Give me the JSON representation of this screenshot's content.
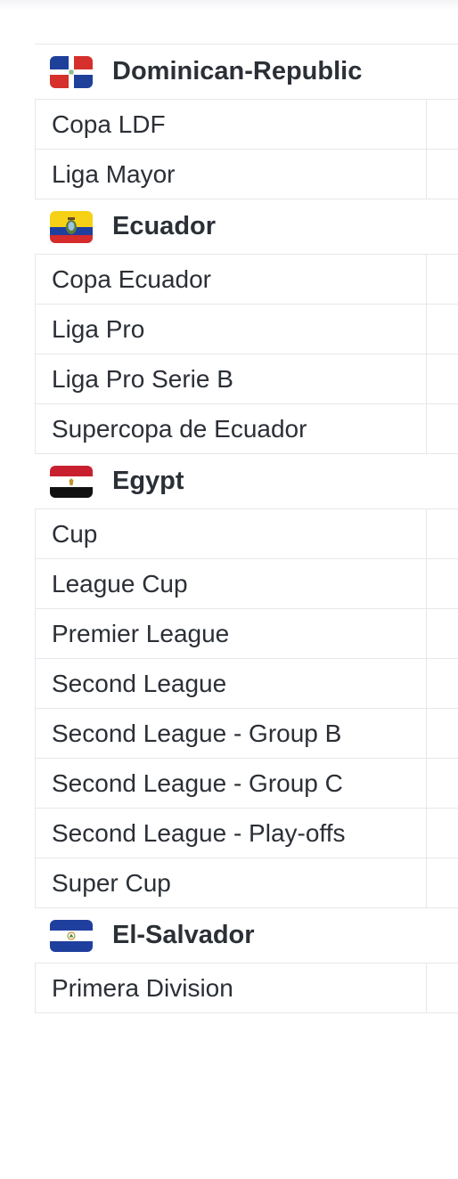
{
  "groups": [
    {
      "country": "Dominican-Republic",
      "flag_icon": "dominican-republic-flag-icon",
      "leagues": [
        "Copa LDF",
        "Liga Mayor"
      ]
    },
    {
      "country": "Ecuador",
      "flag_icon": "ecuador-flag-icon",
      "leagues": [
        "Copa Ecuador",
        "Liga Pro",
        "Liga Pro Serie B",
        "Supercopa de Ecuador"
      ]
    },
    {
      "country": "Egypt",
      "flag_icon": "egypt-flag-icon",
      "leagues": [
        "Cup",
        "League Cup",
        "Premier League",
        "Second League",
        "Second League - Group B",
        "Second League - Group C",
        "Second League - Play-offs",
        "Super Cup"
      ]
    },
    {
      "country": "El-Salvador",
      "flag_icon": "el-salvador-flag-icon",
      "leagues": [
        "Primera Division"
      ]
    }
  ],
  "colors": {
    "text": "#2b2f36",
    "divider": "#e6e8eb",
    "background": "#ffffff"
  }
}
